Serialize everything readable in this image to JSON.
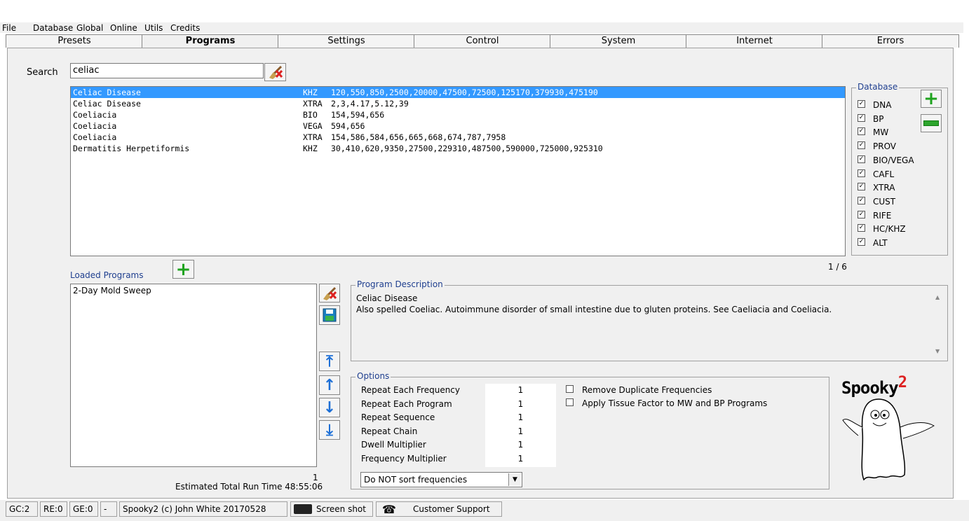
{
  "menu": [
    "File",
    "Database",
    "Global",
    "Online",
    "Utils",
    "Credits"
  ],
  "tabs": [
    "Presets",
    "Programs",
    "Settings",
    "Control",
    "System",
    "Internet",
    "Errors"
  ],
  "active_tab": "Programs",
  "search": {
    "label": "Search",
    "value": "celiac"
  },
  "results": [
    {
      "name": "Celiac Disease",
      "db": "KHZ",
      "freqs": " 120,550,850,2500,20000,47500,72500,125170,379930,475190",
      "selected": true
    },
    {
      "name": "Celiac Disease",
      "db": "XTRA",
      "freqs": "2,3,4.17,5.12,39",
      "selected": false
    },
    {
      "name": "Coeliacia",
      "db": "BIO",
      "freqs": " 154,594,656",
      "selected": false
    },
    {
      "name": "Coeliacia",
      "db": "VEGA",
      "freqs": "594,656",
      "selected": false
    },
    {
      "name": "Coeliacia",
      "db": "XTRA",
      "freqs": "154,586,584,656,665,668,674,787,7958",
      "selected": false
    },
    {
      "name": "Dermatitis Herpetiformis",
      "db": "KHZ",
      "freqs": " 30,410,620,9350,27500,229310,487500,590000,725000,925310",
      "selected": false
    }
  ],
  "page_counter": "1 / 6",
  "database": {
    "legend": "Database",
    "items": [
      "DNA",
      "BP",
      "MW",
      "PROV",
      "BIO/VEGA",
      "CAFL",
      "XTRA",
      "CUST",
      "RIFE",
      "HC/KHZ",
      "ALT"
    ],
    "checked": "✓"
  },
  "loaded": {
    "label": "Loaded Programs",
    "items": [
      "2-Day Mold Sweep"
    ],
    "count": "1"
  },
  "run_time": "Estimated Total Run Time 48:55:06",
  "description": {
    "legend": "Program Description",
    "title": "Celiac Disease",
    "text": "Also spelled Coeliac. Autoimmune disorder of small intestine due to gluten proteins. See Caeliacia and Coeliacia."
  },
  "options": {
    "legend": "Options",
    "rows": [
      {
        "label": "Repeat Each Frequency",
        "value": "1"
      },
      {
        "label": "Repeat Each Program",
        "value": "1"
      },
      {
        "label": "Repeat Sequence",
        "value": "1"
      },
      {
        "label": "Repeat Chain",
        "value": "1"
      },
      {
        "label": "Dwell Multiplier",
        "value": "1"
      },
      {
        "label": "Frequency Multiplier",
        "value": "1"
      }
    ],
    "checks": [
      "Remove Duplicate Frequencies",
      "Apply Tissue Factor to MW and BP Programs"
    ],
    "sort_select": "Do NOT sort frequencies"
  },
  "logo": {
    "text": "Spooky",
    "sup": "2"
  },
  "status": {
    "gc": "GC:2",
    "re": "RE:0",
    "ge": "GE:0",
    "dash": "-",
    "copyright": "Spooky2 (c) John White 20170528",
    "screenshot": "Screen shot",
    "support": "Customer Support"
  }
}
